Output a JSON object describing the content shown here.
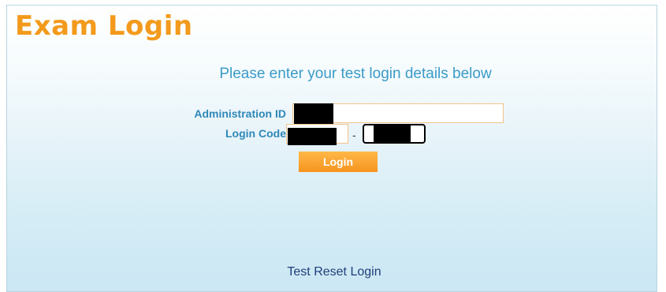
{
  "page": {
    "title": "Exam Login",
    "subtitle": "Please enter your test  login details below"
  },
  "form": {
    "admin_label": "Administration ID",
    "admin_value": "",
    "code_label": "Login Code",
    "code_part1_value": "",
    "code_separator": "-",
    "code_part2_value": "",
    "login_button": "Login"
  },
  "links": {
    "reset": "Test Reset Login"
  },
  "colors": {
    "title": "#f39a1c",
    "subtitle": "#3a9bc8",
    "label": "#2f88b8",
    "button": "#f7941e",
    "link": "#1f3f7a"
  }
}
